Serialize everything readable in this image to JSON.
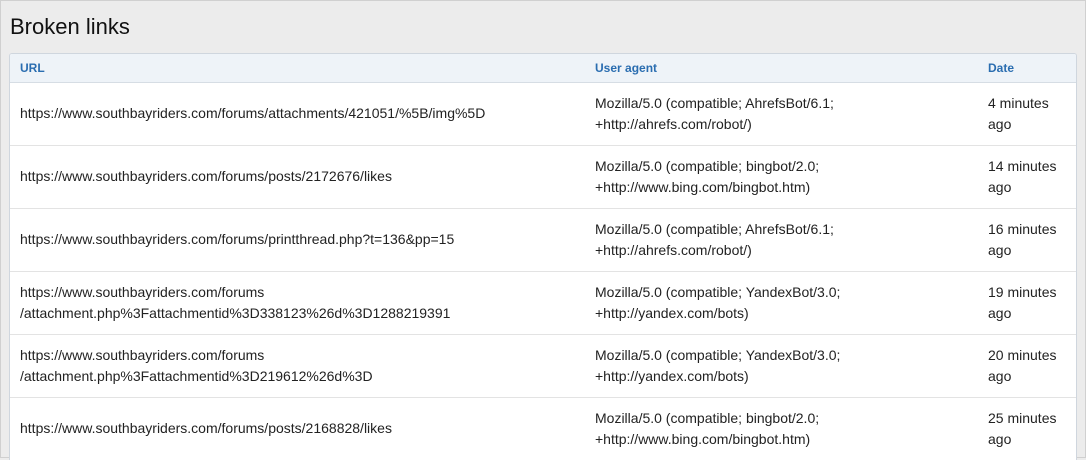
{
  "page": {
    "title": "Broken links"
  },
  "table": {
    "headers": {
      "url": "URL",
      "user_agent": "User agent",
      "date": "Date"
    },
    "rows": [
      {
        "url_line1": "https://www.southbayriders.com/forums/attachments/421051/%5B/img%5D",
        "url_line2": "",
        "ua_line1": "Mozilla/5.0 (compatible; AhrefsBot/6.1;",
        "ua_line2": "+http://ahrefs.com/robot/)",
        "date_line1": "4 minutes",
        "date_line2": "ago"
      },
      {
        "url_line1": "https://www.southbayriders.com/forums/posts/2172676/likes",
        "url_line2": "",
        "ua_line1": "Mozilla/5.0 (compatible; bingbot/2.0;",
        "ua_line2": "+http://www.bing.com/bingbot.htm)",
        "date_line1": "14 minutes",
        "date_line2": "ago"
      },
      {
        "url_line1": "https://www.southbayriders.com/forums/printthread.php?t=136&pp=15",
        "url_line2": "",
        "ua_line1": "Mozilla/5.0 (compatible; AhrefsBot/6.1;",
        "ua_line2": "+http://ahrefs.com/robot/)",
        "date_line1": "16 minutes",
        "date_line2": "ago"
      },
      {
        "url_line1": "https://www.southbayriders.com/forums",
        "url_line2": "/attachment.php%3Fattachmentid%3D338123%26d%3D1288219391",
        "ua_line1": "Mozilla/5.0 (compatible; YandexBot/3.0;",
        "ua_line2": "+http://yandex.com/bots)",
        "date_line1": "19 minutes",
        "date_line2": "ago"
      },
      {
        "url_line1": "https://www.southbayriders.com/forums",
        "url_line2": "/attachment.php%3Fattachmentid%3D219612%26d%3D",
        "ua_line1": "Mozilla/5.0 (compatible; YandexBot/3.0;",
        "ua_line2": "+http://yandex.com/bots)",
        "date_line1": "20 minutes",
        "date_line2": "ago"
      },
      {
        "url_line1": "https://www.southbayriders.com/forums/posts/2168828/likes",
        "url_line2": "",
        "ua_line1": "Mozilla/5.0 (compatible; bingbot/2.0;",
        "ua_line2": "+http://www.bing.com/bingbot.htm)",
        "date_line1": "25 minutes",
        "date_line2": "ago"
      }
    ]
  }
}
